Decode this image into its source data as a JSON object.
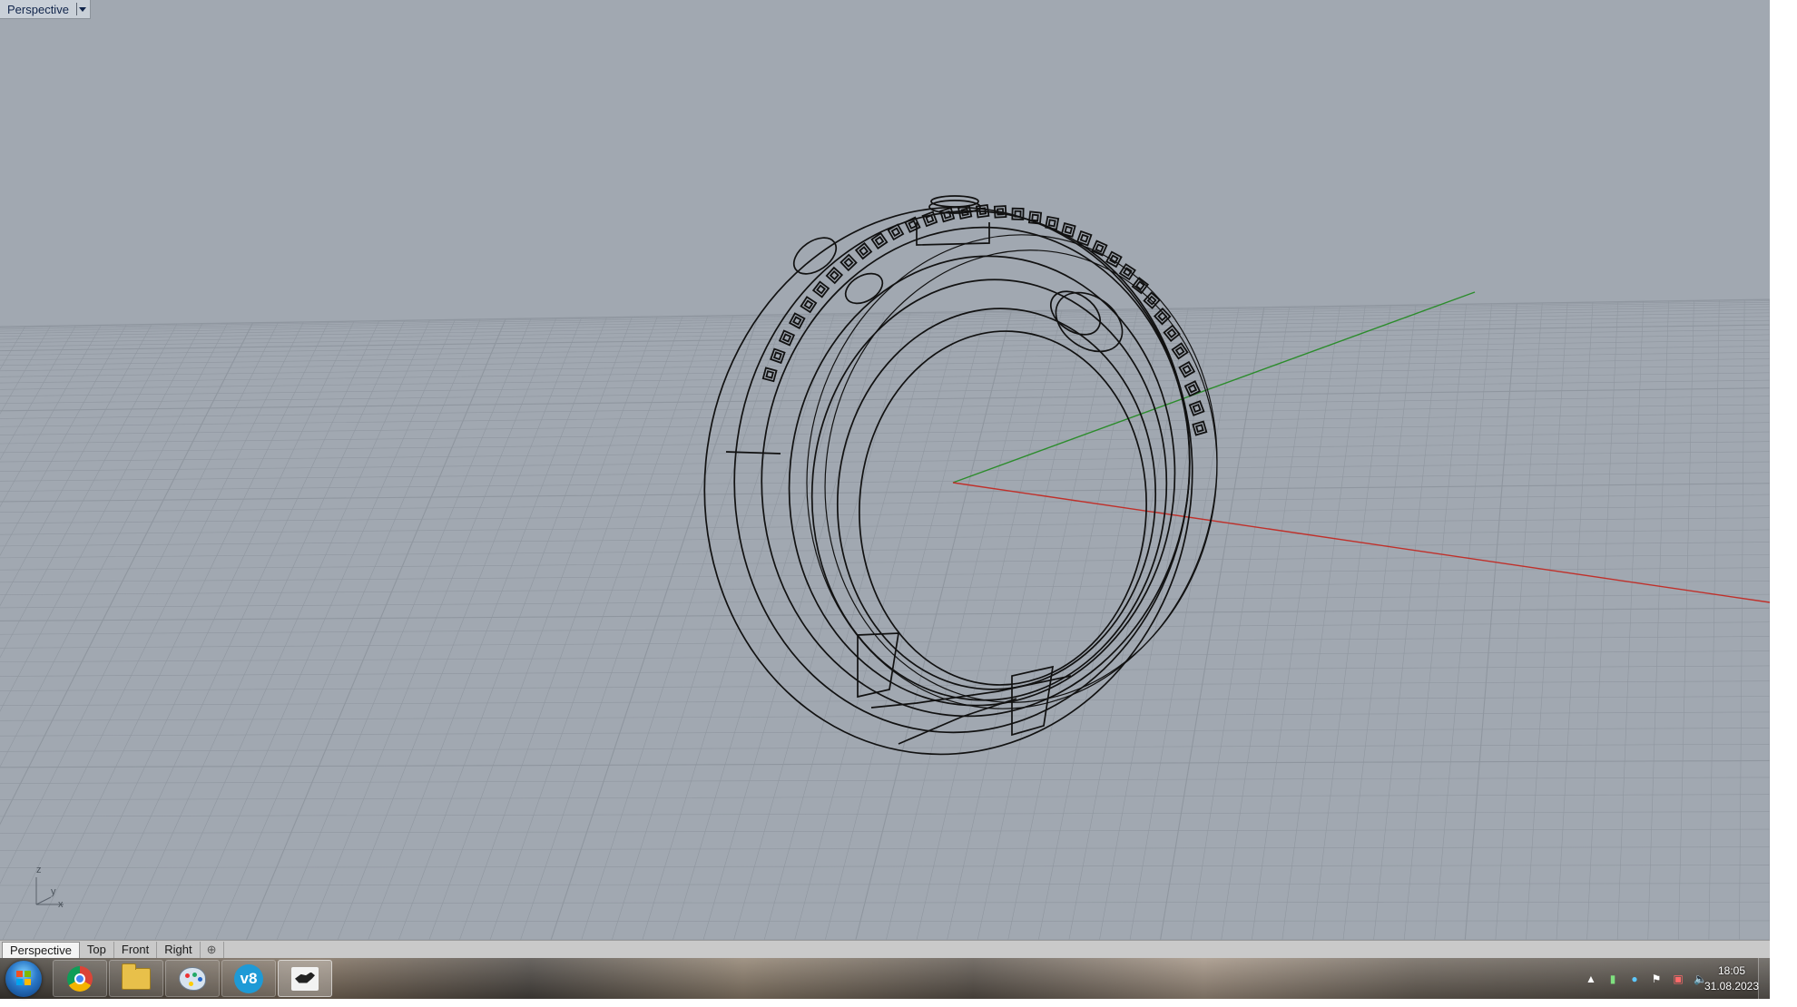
{
  "viewport": {
    "name": "Perspective",
    "background": "#a1a8b1",
    "grid_color": "#8f969f",
    "x_axis_color": "#c0302a",
    "y_axis_color": "#2c8c2c",
    "axis_icon": {
      "z": "z",
      "y": "y",
      "x": "x"
    }
  },
  "tabs": [
    {
      "label": "Perspective",
      "active": true
    },
    {
      "label": "Top",
      "active": false
    },
    {
      "label": "Front",
      "active": false
    },
    {
      "label": "Right",
      "active": false
    },
    {
      "label": "⊕",
      "active": false
    }
  ],
  "taskbar": {
    "apps": [
      "start-orb",
      "chrome-icon",
      "folder-icon",
      "paint-icon",
      "v8-icon",
      "rhino-icon"
    ],
    "tray_icons": [
      "tray-expand-icon",
      "network-icon",
      "globe-icon",
      "flag-icon",
      "display-icon",
      "volume-icon"
    ],
    "time": "18:05",
    "date": "31.08.2023"
  }
}
